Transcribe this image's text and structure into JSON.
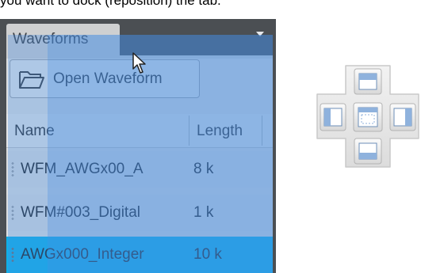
{
  "caption": "you want to dock (reposition) the tab.",
  "panel": {
    "tab_label": "Waveforms",
    "open_button_label": "Open Waveform",
    "columns": [
      "Name",
      "Length"
    ],
    "rows": [
      {
        "name": "WFM_AWGx00_A",
        "length": "8 k",
        "selected": false
      },
      {
        "name": "WFM#003_Digital",
        "length": "1 k",
        "selected": false
      },
      {
        "name": "AWGx000_Integer",
        "length": "10 k",
        "selected": true
      }
    ]
  },
  "icons": {
    "folder": "folder-icon",
    "dropdown": "chevron-down-icon",
    "cursor": "mouse-cursor-icon",
    "dock_guide": "dock-position-guide-icon"
  },
  "colors": {
    "drag_overlay": "#468ce1",
    "selected_row": "#0fb1e8",
    "panel_frame": "#4b4f53"
  }
}
